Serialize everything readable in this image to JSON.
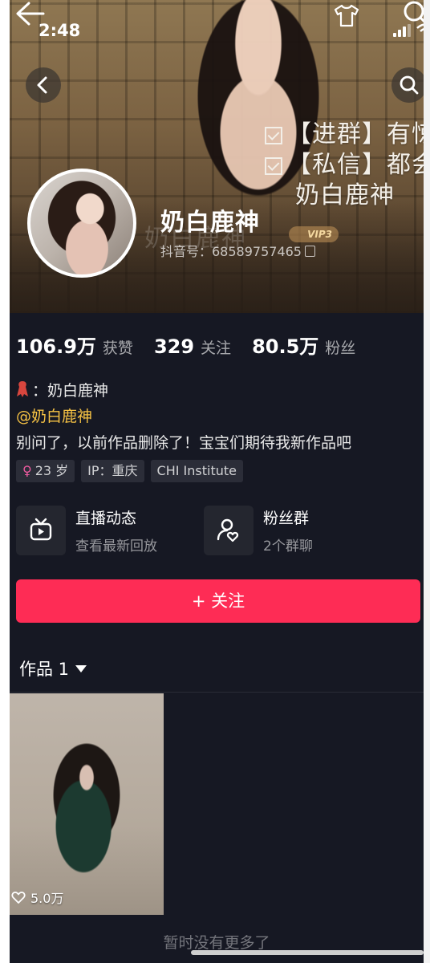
{
  "status_bar": {
    "time": "2:48"
  },
  "banner": {
    "line1": "【进群】有惊",
    "line2": "【私信】都会",
    "line3": "奶白鹿神"
  },
  "profile": {
    "name": "奶白鹿神",
    "ghost_name": "奶白鹿神",
    "vip_label": "VIP3",
    "douyin_id": "抖音号：68589757465"
  },
  "stats": [
    {
      "value": "106.9万",
      "label": "获赞"
    },
    {
      "value": "329",
      "label": "关注"
    },
    {
      "value": "80.5万",
      "label": "粉丝"
    }
  ],
  "bio": {
    "line1": "：奶白鹿神",
    "line2": "@奶白鹿神",
    "line3": "别问了，以前作品删除了！宝宝们期待我新作品吧"
  },
  "tags": {
    "age": "23 岁",
    "ip": "IP：重庆",
    "school": "CHI Institute"
  },
  "features": {
    "live": {
      "title": "直播动态",
      "sub": "查看最新回放"
    },
    "fans": {
      "title": "粉丝群",
      "sub": "2个群聊"
    }
  },
  "follow_button": "+ 关注",
  "works_tab": "作品 1",
  "video": {
    "likes": "5.0万"
  },
  "footer_text": "暂时没有更多了",
  "colors": {
    "background": "#161823",
    "accent": "#fe2c55",
    "mention": "#f6c244"
  }
}
